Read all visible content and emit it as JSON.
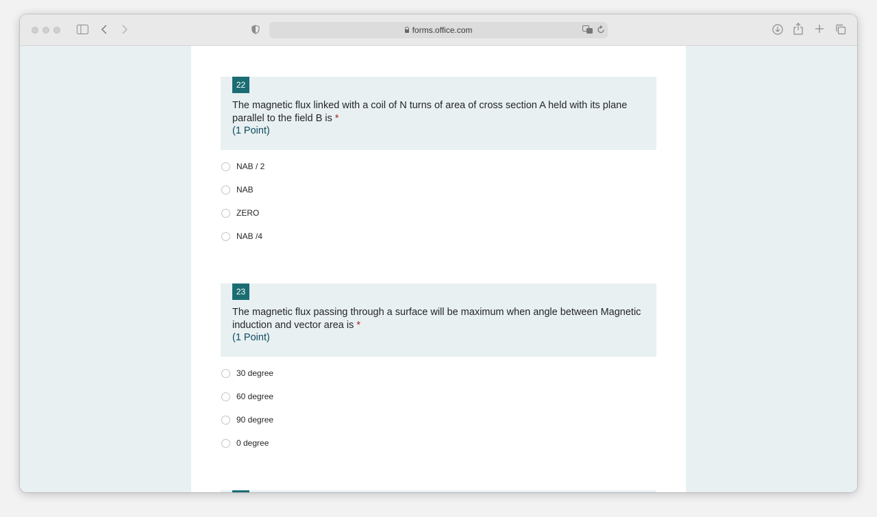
{
  "browser": {
    "url": "forms.office.com",
    "icons": [
      "sidebar-icon",
      "back-arrow-icon",
      "forward-arrow-icon",
      "shield-icon",
      "lock-icon",
      "translate-icon",
      "reload-icon",
      "download-icon",
      "share-icon",
      "new-tab-icon",
      "tabs-overview-icon"
    ]
  },
  "questions": [
    {
      "number": "22",
      "text": " The magnetic flux linked with a coil of N turns of area of cross section A held with its plane parallel to the field B is ",
      "required_mark": "*",
      "points": "(1 Point)",
      "options": [
        "NAB / 2",
        "NAB",
        "ZERO",
        "NAB /4"
      ]
    },
    {
      "number": "23",
      "text": "The magnetic flux passing through a surface will be maximum when angle between Magnetic induction and vector area is ",
      "required_mark": "*",
      "points": "(1 Point)",
      "options": [
        "30 degree",
        "60 degree",
        "90 degree",
        "0 degree"
      ]
    }
  ],
  "colors": {
    "accent": "#1b6d73",
    "question_bg": "#e8f0f2",
    "required": "#a4262c",
    "points": "#0e4a5e"
  }
}
